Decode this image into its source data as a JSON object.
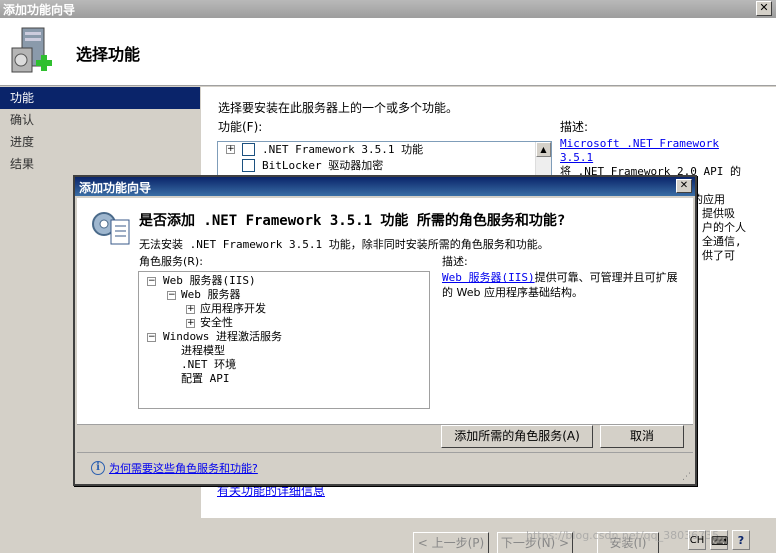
{
  "window": {
    "title": "添加功能向导",
    "close": "✕"
  },
  "header": {
    "title": "选择功能"
  },
  "nav": {
    "items": [
      {
        "label": "功能",
        "selected": true
      },
      {
        "label": "确认",
        "selected": false
      },
      {
        "label": "进度",
        "selected": false
      },
      {
        "label": "结果",
        "selected": false
      }
    ]
  },
  "main": {
    "instruction": "选择要安装在此服务器上的一个或多个功能。",
    "features_label": "功能(F):",
    "features": [
      {
        "label": ".NET Framework 3.5.1 功能",
        "expandable": true,
        "checked": false
      },
      {
        "label": "BitLocker 驱动器加密",
        "expandable": false,
        "checked": false
      }
    ],
    "description_label": "描述:",
    "description_link": "Microsoft .NET Framework 3.5.1",
    "description_lines": [
      "将 .NET Framework 2.0 API 的功",
      "能与用于构建具有以下功能的应用",
      "提供吸",
      "户的个人",
      "全通信,",
      "供了可"
    ],
    "more_info_link": "有关功能的详细信息"
  },
  "buttons": {
    "prev": "< 上一步(P)",
    "next": "下一步(N) >",
    "install": "安装(I)"
  },
  "dialog": {
    "title": "添加功能向导",
    "close": "✕",
    "heading": "是否添加 .NET Framework 3.5.1 功能 所需的角色服务和功能?",
    "message": "无法安装 .NET Framework 3.5.1 功能，除非同时安装所需的角色服务和功能。",
    "roles_label": "角色服务(R):",
    "tree": [
      {
        "label": "Web 服务器(IIS)",
        "indent": 0,
        "toggle": "−"
      },
      {
        "label": "Web 服务器",
        "indent": 1,
        "toggle": "−"
      },
      {
        "label": "应用程序开发",
        "indent": 2,
        "toggle": "+"
      },
      {
        "label": "安全性",
        "indent": 2,
        "toggle": "+"
      },
      {
        "label": "Windows 进程激活服务",
        "indent": 0,
        "toggle": "−"
      },
      {
        "label": "进程模型",
        "indent": 1,
        "toggle": ""
      },
      {
        "label": ".NET 环境",
        "indent": 1,
        "toggle": ""
      },
      {
        "label": "配置 API",
        "indent": 1,
        "toggle": ""
      }
    ],
    "desc_label": "描述:",
    "desc_link": "Web 服务器(IIS)",
    "desc_text": "提供可靠、可管理并且可扩展的 Web 应用程序基础结构。",
    "add_button": "添加所需的角色服务(A)",
    "cancel_button": "取消",
    "why_link": "为何需要这些角色服务和功能?"
  },
  "watermark": "https://blog.csdn.net/qq_38036735",
  "tray": {
    "lang": "CH",
    "help": "?"
  }
}
